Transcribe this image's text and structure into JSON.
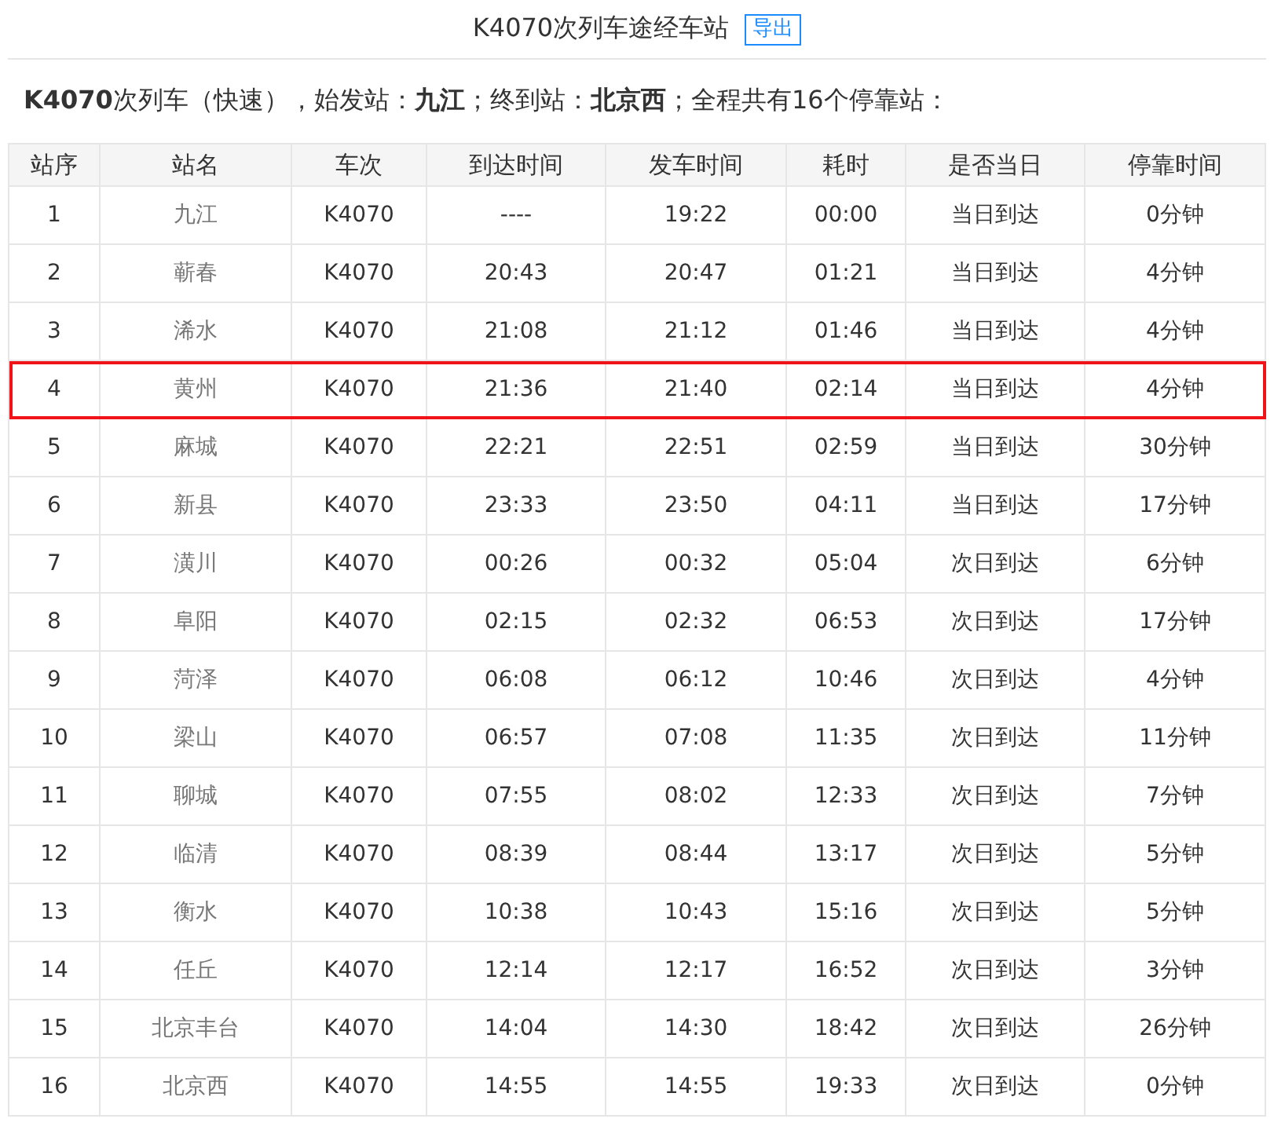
{
  "title": "K4070次列车途经车站",
  "export_button": "导出",
  "summary": "**K4070**次列车（快速），始发站：**九江**；终到站：**北京西**；全程共有16个停靠站：",
  "table": {
    "columns": [
      "站序",
      "站名",
      "车次",
      "到达时间",
      "发车时间",
      "耗时",
      "是否当日",
      "停靠时间"
    ],
    "rows": [
      {
        "cells": [
          "1",
          "九江",
          "K4070",
          "----",
          "19:22",
          "00:00",
          "当日到达",
          "0分钟"
        ],
        "selected": false
      },
      {
        "cells": [
          "2",
          "蕲春",
          "K4070",
          "20:43",
          "20:47",
          "01:21",
          "当日到达",
          "4分钟"
        ],
        "selected": false
      },
      {
        "cells": [
          "3",
          "浠水",
          "K4070",
          "21:08",
          "21:12",
          "01:46",
          "当日到达",
          "4分钟"
        ],
        "selected": false
      },
      {
        "cells": [
          "4",
          "黄州",
          "K4070",
          "21:36",
          "21:40",
          "02:14",
          "当日到达",
          "4分钟"
        ],
        "selected": true
      },
      {
        "cells": [
          "5",
          "麻城",
          "K4070",
          "22:21",
          "22:51",
          "02:59",
          "当日到达",
          "30分钟"
        ],
        "selected": false
      },
      {
        "cells": [
          "6",
          "新县",
          "K4070",
          "23:33",
          "23:50",
          "04:11",
          "当日到达",
          "17分钟"
        ],
        "selected": false
      },
      {
        "cells": [
          "7",
          "潢川",
          "K4070",
          "00:26",
          "00:32",
          "05:04",
          "次日到达",
          "6分钟"
        ],
        "selected": false
      },
      {
        "cells": [
          "8",
          "阜阳",
          "K4070",
          "02:15",
          "02:32",
          "06:53",
          "次日到达",
          "17分钟"
        ],
        "selected": false
      },
      {
        "cells": [
          "9",
          "菏泽",
          "K4070",
          "06:08",
          "06:12",
          "10:46",
          "次日到达",
          "4分钟"
        ],
        "selected": false
      },
      {
        "cells": [
          "10",
          "梁山",
          "K4070",
          "06:57",
          "07:08",
          "11:35",
          "次日到达",
          "11分钟"
        ],
        "selected": false
      },
      {
        "cells": [
          "11",
          "聊城",
          "K4070",
          "07:55",
          "08:02",
          "12:33",
          "次日到达",
          "7分钟"
        ],
        "selected": false
      },
      {
        "cells": [
          "12",
          "临清",
          "K4070",
          "08:39",
          "08:44",
          "13:17",
          "次日到达",
          "5分钟"
        ],
        "selected": false
      },
      {
        "cells": [
          "13",
          "衡水",
          "K4070",
          "10:38",
          "10:43",
          "15:16",
          "次日到达",
          "5分钟"
        ],
        "selected": false
      },
      {
        "cells": [
          "14",
          "任丘",
          "K4070",
          "12:14",
          "12:17",
          "16:52",
          "次日到达",
          "3分钟"
        ],
        "selected": false
      },
      {
        "cells": [
          "15",
          "北京丰台",
          "K4070",
          "14:04",
          "14:30",
          "18:42",
          "次日到达",
          "26分钟"
        ],
        "selected": false
      },
      {
        "cells": [
          "16",
          "北京西",
          "K4070",
          "14:55",
          "14:55",
          "19:33",
          "次日到达",
          "0分钟"
        ],
        "selected": false
      }
    ]
  }
}
